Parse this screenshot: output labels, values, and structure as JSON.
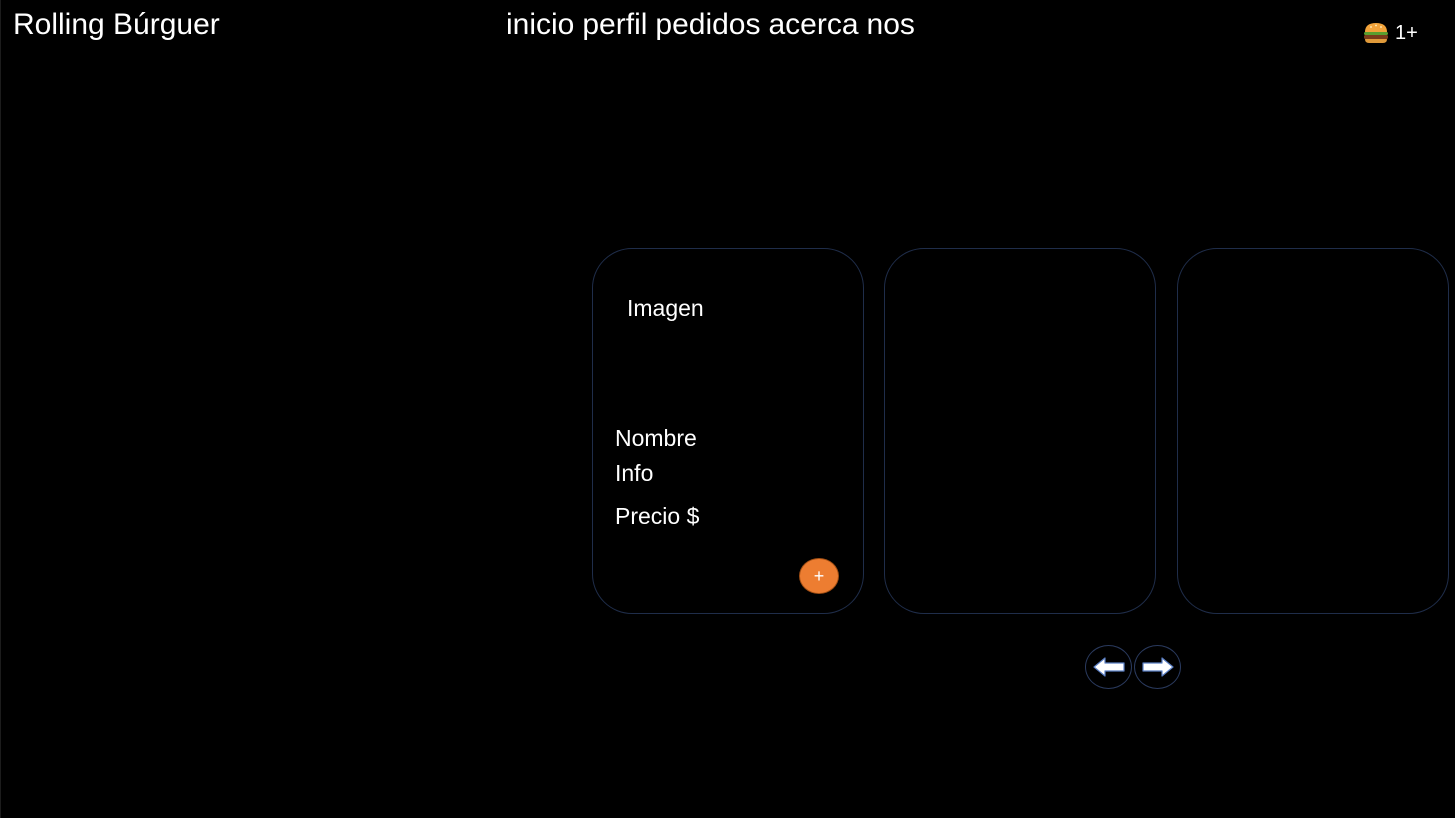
{
  "header": {
    "brand": "Rolling Búrguer",
    "nav": [
      "inicio",
      "perfil",
      "pedidos",
      "acerca",
      "nos"
    ],
    "cart": {
      "icon": "burger-icon",
      "count": "1+"
    }
  },
  "cards": [
    {
      "image_label": "Imagen",
      "name": "Nombre",
      "info": "Info",
      "price": "Precio $",
      "add_label": "+"
    },
    {},
    {}
  ],
  "carousel": {
    "prev_icon": "arrow-left-icon",
    "next_icon": "arrow-right-icon"
  },
  "colors": {
    "background": "#000000",
    "card_border": "#1f2d4a",
    "accent": "#ed7d31"
  }
}
